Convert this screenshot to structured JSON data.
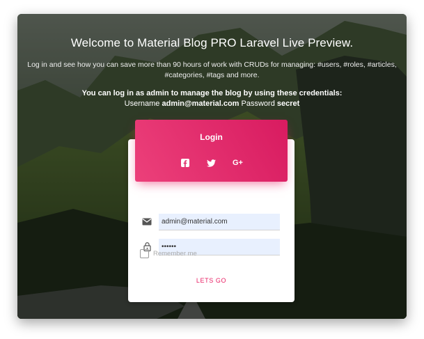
{
  "header": {
    "welcome": "Welcome to Material Blog PRO Laravel Live Preview.",
    "intro": "Log in and see how you can save more than 90 hours of work with CRUDs for managing: #users, #roles, #articles, #categories, #tags and more.",
    "creds_line": "You can log in as admin to manage the blog by using these credentials:",
    "username_label": "Username",
    "username_value": "admin@material.com",
    "password_label": "Password",
    "password_value": "secret"
  },
  "login": {
    "title": "Login",
    "socials": [
      {
        "icon": "facebook-icon",
        "glyph": "f"
      },
      {
        "icon": "twitter-icon",
        "glyph": "t"
      },
      {
        "icon": "google-plus-icon",
        "glyph": "G+"
      }
    ],
    "email_value": "admin@material.com",
    "password_value": "••••••",
    "remember_label": "Remember me",
    "submit_label": "LETS GO"
  },
  "colors": {
    "accent": "#e91e63",
    "input_bg": "#e8f0fe"
  }
}
